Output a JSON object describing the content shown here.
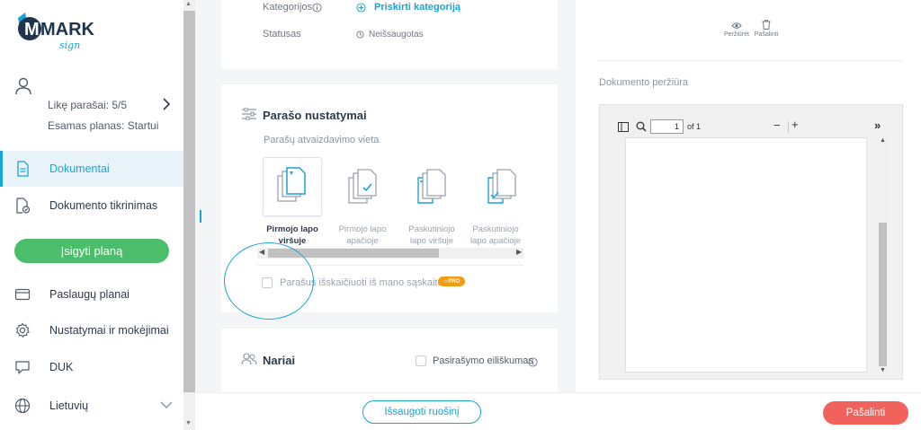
{
  "brand": {
    "logo_main": "MARK",
    "logo_sub": "sign"
  },
  "sidebar": {
    "credits_label": "Likę parašai: 5/5",
    "plan_label": "Esamas planas: Startui",
    "nav": [
      {
        "label": "Dokumentai",
        "icon": "document-icon",
        "active": true
      },
      {
        "label": "Dokumento tikrinimas",
        "icon": "document-check-icon",
        "active": false
      }
    ],
    "buy_button": "Įsigyti planą",
    "nav_bottom": [
      {
        "label": "Paslaugų planai",
        "icon": "card-icon"
      },
      {
        "label": "Nustatymai ir mokėjimai",
        "icon": "gear-icon"
      },
      {
        "label": "DUK",
        "icon": "chat-icon"
      },
      {
        "label": "Lietuvių",
        "icon": "globe-icon"
      }
    ]
  },
  "details": {
    "category_label": "Kategorijos",
    "category_action": "Priskirti kategoriją",
    "status_label": "Statusas",
    "status_value": "Neišsaugotas"
  },
  "signature_settings": {
    "title": "Parašo nustatymai",
    "placement_label": "Parašų atvaizdavimo vieta",
    "positions": [
      {
        "label_line1": "Pirmojo lapo",
        "label_line2": "viršuje",
        "selected": true
      },
      {
        "label_line1": "Pirmojo lapo",
        "label_line2": "apačioje",
        "selected": false
      },
      {
        "label_line1": "Paskutiniojo",
        "label_line2": "lapo viršuje",
        "selected": false
      },
      {
        "label_line1": "Paskutiniojo",
        "label_line2": "lapo apačioje",
        "selected": false
      }
    ],
    "deduct_label": "Parašus išskaičiuoti iš mano sąskaitos",
    "pro_badge": "PRO"
  },
  "members": {
    "title": "Nariai",
    "order_label": "Pasirašymo eiliškumas"
  },
  "preview": {
    "view_label": "Peržiūrėt",
    "delete_icon_label": "Pašalinti",
    "title": "Dokumento peržiūra",
    "page_value": "1",
    "page_of": "of 1"
  },
  "footer": {
    "save_draft": "Išsaugoti ruošinį",
    "delete": "Pašalinti"
  },
  "colors": {
    "accent": "#19a4d6",
    "green": "#4cbd6b",
    "danger": "#f2625c",
    "pro": "#f39c12"
  }
}
